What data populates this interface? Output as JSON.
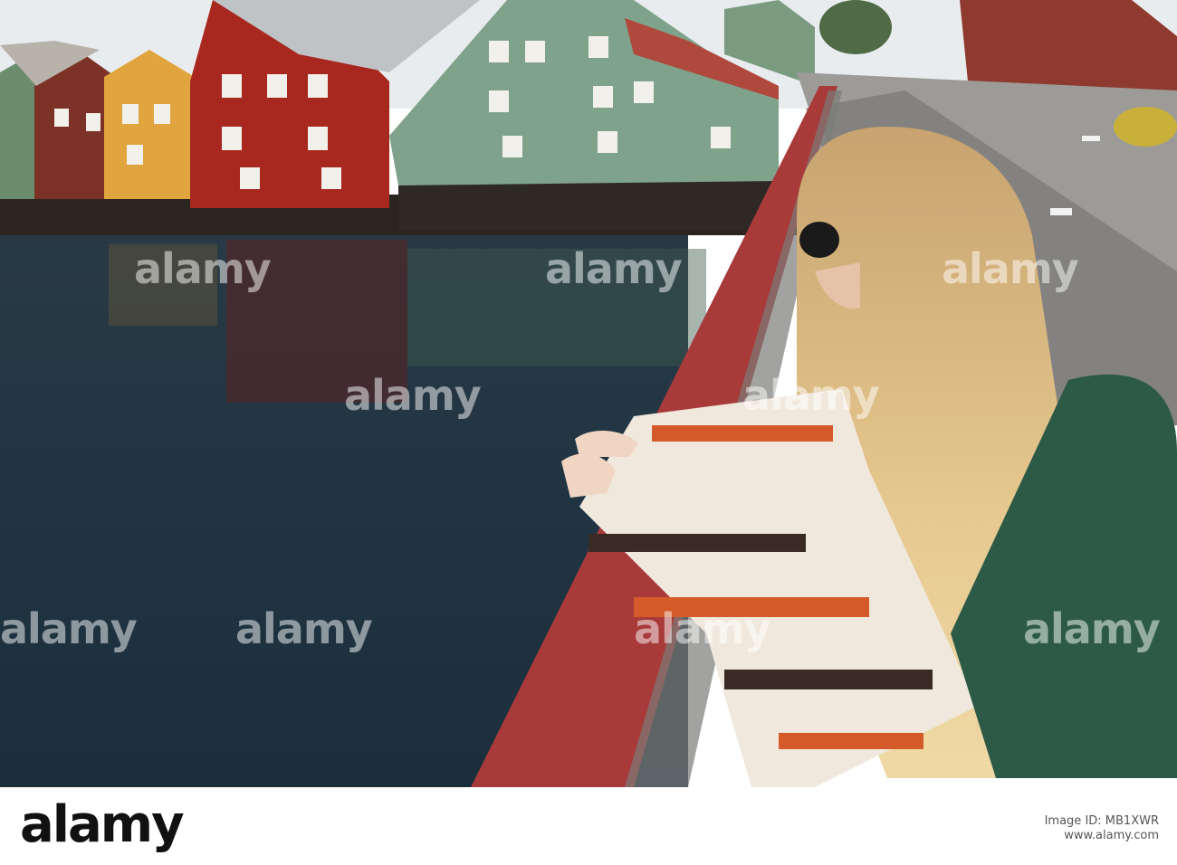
{
  "photo": {
    "scene": "stock-photo",
    "watermark_text": "alamy"
  },
  "footer": {
    "logo": "alamy",
    "image_id_label": "Image ID: MB1XWR",
    "site": "www.alamy.com"
  }
}
